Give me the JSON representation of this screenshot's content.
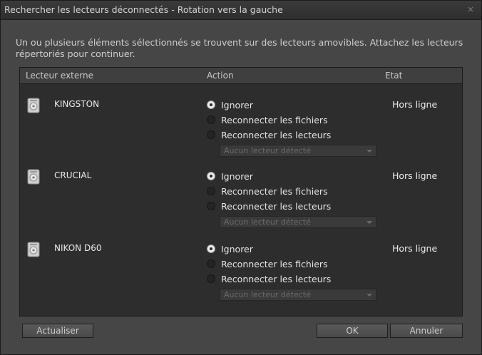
{
  "window": {
    "title": "Rechercher les lecteurs déconnectés - Rotation vers la gauche",
    "close_glyph": "×"
  },
  "message": "Un ou plusieurs éléments sélectionnés se trouvent sur des lecteurs amovibles. Attachez les lecteurs répertoriés pour continuer.",
  "table": {
    "headers": {
      "drive": "Lecteur externe",
      "action": "Action",
      "status": "Etat"
    },
    "rows": [
      {
        "name": "KINGSTON",
        "status": "Hors ligne",
        "options": [
          "Ignorer",
          "Reconnecter les fichiers",
          "Reconnecter les lecteurs"
        ],
        "selected_option": "Ignorer",
        "dropdown": "Aucun lecteur détecté",
        "icon": "drive-icon"
      },
      {
        "name": "CRUCIAL",
        "status": "Hors ligne",
        "options": [
          "Ignorer",
          "Reconnecter les fichiers",
          "Reconnecter les lecteurs"
        ],
        "selected_option": "Ignorer",
        "dropdown": "Aucun lecteur détecté",
        "icon": "drive-icon"
      },
      {
        "name": "NIKON D60",
        "status": "Hors ligne",
        "options": [
          "Ignorer",
          "Reconnecter les fichiers",
          "Reconnecter les lecteurs"
        ],
        "selected_option": "Ignorer",
        "dropdown": "Aucun lecteur détecté",
        "icon": "drive-icon"
      }
    ]
  },
  "buttons": {
    "refresh": "Actualiser",
    "ok": "OK",
    "cancel": "Annuler"
  }
}
